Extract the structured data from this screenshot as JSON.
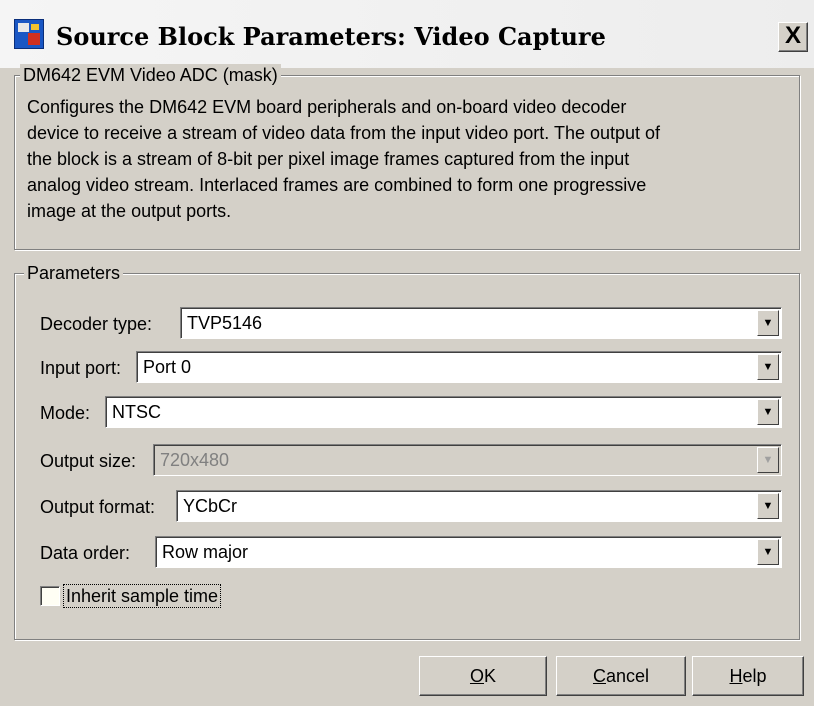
{
  "window": {
    "title": "Source Block Parameters: Video Capture",
    "close_symbol": "X",
    "app_icon": "simulink-block-icon"
  },
  "mask": {
    "legend": "DM642 EVM Video ADC (mask)",
    "description_lines": [
      "Configures the DM642 EVM board peripherals and on-board video decoder",
      "device to receive a stream of video data from the input video port. The output of",
      "the block is a stream of 8-bit per pixel  image frames captured from the input",
      "analog video stream. Interlaced frames are combined to form one progressive",
      "image at the output ports."
    ]
  },
  "parameters": {
    "legend": "Parameters",
    "decoder_type": {
      "label": "Decoder type:",
      "value": "TVP5146"
    },
    "input_port": {
      "label": "Input port:",
      "value": "Port 0"
    },
    "mode": {
      "label": "Mode:",
      "value": "NTSC"
    },
    "output_size": {
      "label": "Output size:",
      "value": "720x480",
      "disabled": true
    },
    "output_format": {
      "label": "Output format:",
      "value": "YCbCr"
    },
    "data_order": {
      "label": "Data order:",
      "value": "Row major"
    },
    "inherit_sample_time": {
      "label": "Inherit sample time",
      "checked": false
    }
  },
  "buttons": {
    "ok": {
      "mnemonic": "O",
      "rest": "K"
    },
    "cancel": {
      "mnemonic": "C",
      "rest": "ancel"
    },
    "help": {
      "mnemonic": "H",
      "rest": "elp"
    }
  },
  "icons": {
    "dropdown_arrow": "▼"
  }
}
